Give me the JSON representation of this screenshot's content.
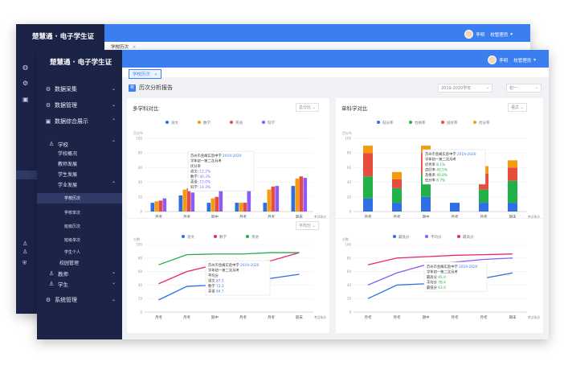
{
  "app": {
    "name": "楚慧通 · 电子学生证"
  },
  "user": {
    "name": "李明",
    "role": "校管理员"
  },
  "back_tab": {
    "label": "学校历次",
    "close": "×"
  },
  "tab": {
    "label": "学校历次",
    "close": "×"
  },
  "page_title": {
    "badge": "校",
    "text": "历次分析报告"
  },
  "filters": {
    "year": "2019-2020学年",
    "grade": "初一"
  },
  "sidebar": {
    "items": [
      {
        "label": "数据采集"
      },
      {
        "label": "数据管理"
      },
      {
        "label": "数据综合展示"
      }
    ],
    "school": "学校",
    "school_sub": [
      "学校概况",
      "教师发展",
      "学生发展",
      "学业发展"
    ],
    "academic_sub": [
      "学校历次",
      "学校单次",
      "班级历次",
      "班级单次"
    ],
    "personal": [
      "学生个人",
      "校园管理"
    ],
    "teacher": "教师",
    "student": "学生",
    "system": "系统管理"
  },
  "back_sidebar": {
    "icons": [
      "globe-icon",
      "gear-icon",
      "box-icon"
    ]
  },
  "cards": {
    "multi": {
      "title": "多学科对比",
      "select": "总分比",
      "line_select": "平均分"
    },
    "single": {
      "title": "单科学对比",
      "select": "语文"
    }
  },
  "chart_data": [
    {
      "type": "bar",
      "title": "多学科对比",
      "ylabel": "百分%",
      "ylim": [
        0,
        100
      ],
      "yticks": [
        0,
        20,
        40,
        60,
        80,
        100
      ],
      "categories": [
        "月考",
        "月考",
        "期中",
        "月考",
        "月考",
        "期末"
      ],
      "xlabel": "考试场次",
      "series": [
        {
          "name": "语文",
          "color": "#2f6fe3",
          "values": [
            12,
            22,
            12,
            12,
            12,
            35
          ]
        },
        {
          "name": "数学",
          "color": "#f39c12",
          "values": [
            14,
            30,
            18,
            12,
            30,
            45
          ]
        },
        {
          "name": "英语",
          "color": "#e74c3c",
          "values": [
            15,
            32,
            20,
            12,
            34,
            48
          ]
        },
        {
          "name": "科学",
          "color": "#8b5cf6",
          "values": [
            18,
            26,
            28,
            40,
            35,
            46
          ]
        }
      ],
      "tooltip": {
        "school": "苏州市金阊实验中学",
        "year": "2019-2020",
        "exam": "学年初一第二次月考",
        "metric": "优分率",
        "rows": [
          {
            "label": "语文:",
            "value": "12.2%"
          },
          {
            "label": "数学:",
            "value": "40.3%"
          },
          {
            "label": "英语:",
            "value": "15.0%"
          },
          {
            "label": "科学:",
            "value": "14.3%"
          }
        ]
      }
    },
    {
      "type": "line",
      "ylabel": "分数",
      "ylim": [
        0,
        100
      ],
      "yticks": [
        0,
        20,
        40,
        60,
        80,
        100
      ],
      "categories": [
        "月考",
        "月考",
        "期中",
        "月考",
        "月考",
        "期末"
      ],
      "xlabel": "考试场次",
      "series": [
        {
          "name": "语文",
          "color": "#2f6fe3",
          "values": [
            18,
            38,
            40,
            42,
            50,
            56
          ]
        },
        {
          "name": "数学",
          "color": "#e8247a",
          "values": [
            42,
            60,
            70,
            74,
            76,
            88
          ]
        },
        {
          "name": "英语",
          "color": "#21b04a",
          "values": [
            70,
            85,
            86,
            86,
            88,
            88
          ]
        }
      ],
      "tooltip": {
        "school": "苏州市金阊实验中学",
        "year": "2019-2020",
        "exam": "学年初一第二次月考",
        "metric": "平均分",
        "rows": [
          {
            "label": "语文",
            "value": "87.3"
          },
          {
            "label": "数学",
            "value": "72.3"
          },
          {
            "label": "英语",
            "value": "84.7"
          }
        ]
      }
    },
    {
      "type": "bar",
      "stacked": true,
      "title": "单科学对比",
      "ylabel": "百分%",
      "ylim": [
        0,
        100
      ],
      "yticks": [
        0,
        20,
        40,
        60,
        80,
        100
      ],
      "categories": [
        "月考",
        "月考",
        "期中",
        "月考",
        "月考",
        "期末"
      ],
      "xlabel": "考试场次",
      "series": [
        {
          "name": "低分率",
          "color": "#2f6fe3",
          "values": [
            18,
            12,
            20,
            12,
            12,
            12
          ]
        },
        {
          "name": "合格率",
          "color": "#21b04a",
          "values": [
            30,
            20,
            30,
            0,
            18,
            30
          ]
        },
        {
          "name": "良好率",
          "color": "#e74c3c",
          "values": [
            32,
            12,
            30,
            0,
            22,
            18
          ]
        },
        {
          "name": "优分率",
          "color": "#f39c12",
          "values": [
            10,
            10,
            10,
            0,
            10,
            10
          ]
        }
      ],
      "tooltip": {
        "school": "苏州市金阊实验中学",
        "year": "2019-2020",
        "exam": "学年初一第二次月考",
        "rows": [
          {
            "label": "优秀率",
            "value": "8.1%"
          },
          {
            "label": "良好率",
            "value": "40.5%"
          },
          {
            "label": "及格率",
            "value": "40.8%"
          },
          {
            "label": "低分率",
            "value": "8.7%"
          }
        ]
      }
    },
    {
      "type": "line",
      "ylabel": "分数",
      "ylim": [
        0,
        100
      ],
      "yticks": [
        0,
        20,
        40,
        60,
        80,
        100
      ],
      "categories": [
        "月考",
        "月考",
        "期中",
        "月考",
        "月考",
        "期末"
      ],
      "xlabel": "考试场次",
      "series": [
        {
          "name": "最低分",
          "color": "#2f6fe3",
          "values": [
            20,
            40,
            42,
            44,
            50,
            58
          ]
        },
        {
          "name": "平均分",
          "color": "#8b5cf6",
          "values": [
            40,
            58,
            70,
            74,
            78,
            80
          ]
        },
        {
          "name": "最高分",
          "color": "#e8247a",
          "values": [
            70,
            80,
            82,
            84,
            85,
            86
          ]
        }
      ],
      "tooltip": {
        "school": "苏州市金阊实验中学",
        "year": "2019-2020",
        "exam": "学年初一第二次月考",
        "rows": [
          {
            "label": "最高分",
            "value": "95.0"
          },
          {
            "label": "平均分",
            "value": "78.4"
          },
          {
            "label": "最低分",
            "value": "63.0"
          }
        ]
      }
    }
  ]
}
